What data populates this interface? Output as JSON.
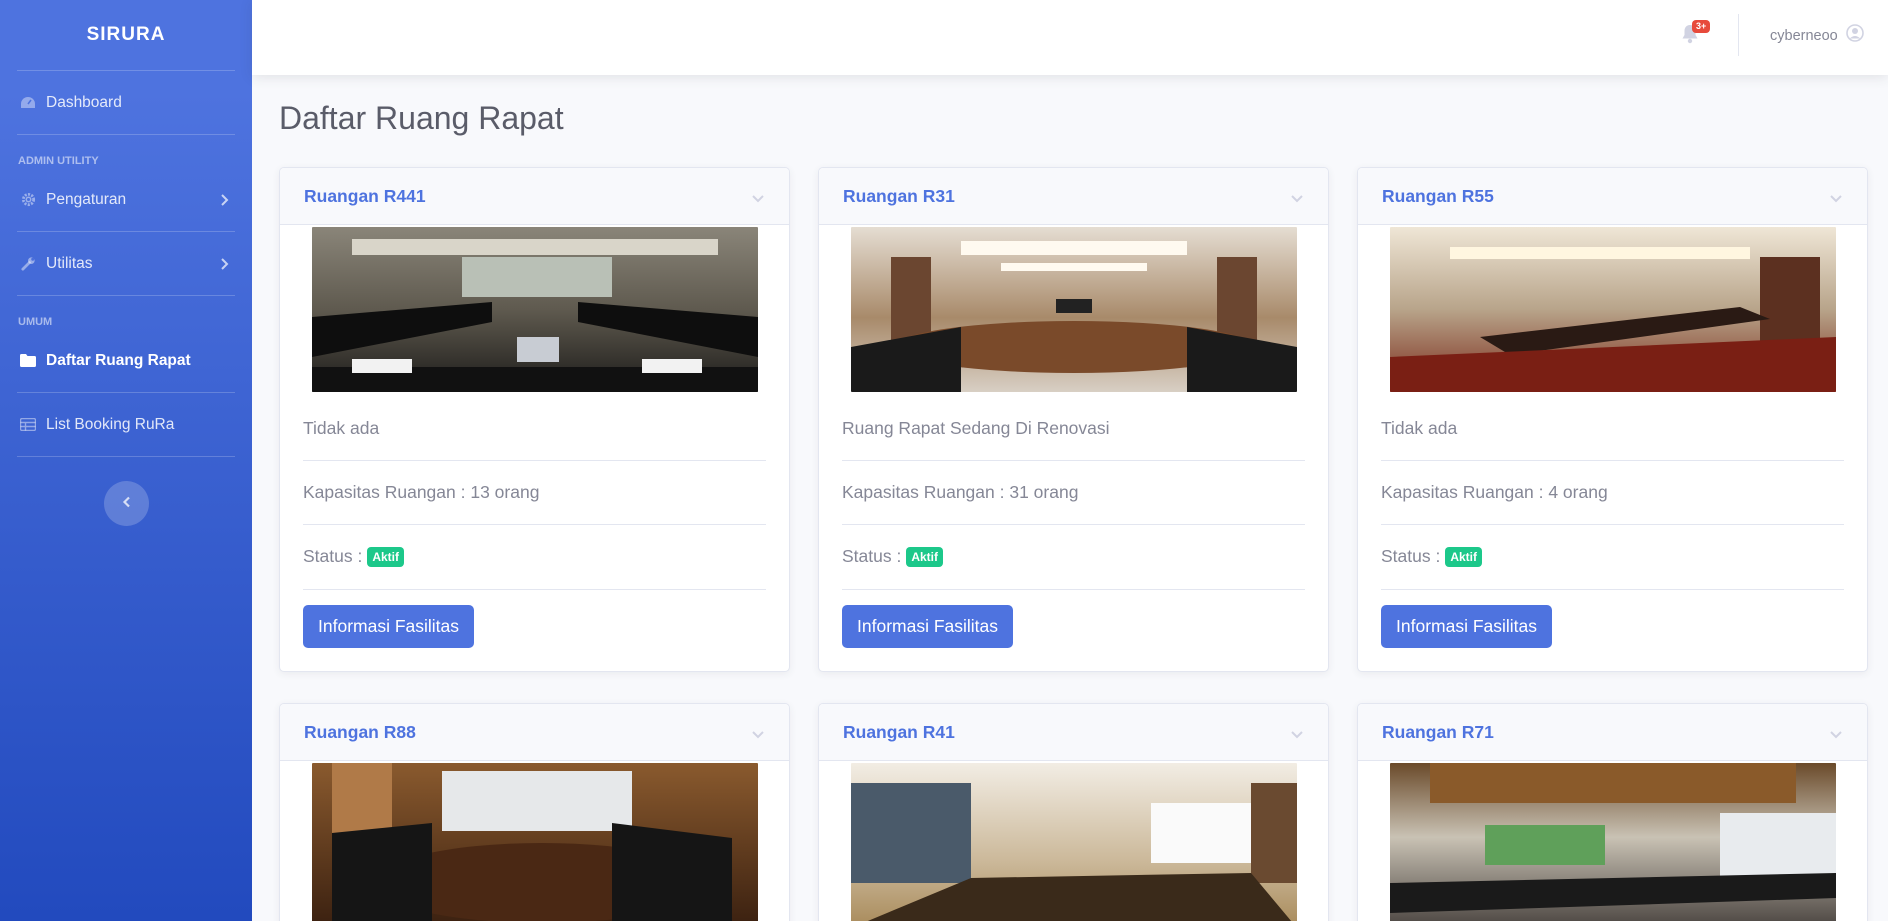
{
  "app": {
    "brand": "SIRURA"
  },
  "sidebar": {
    "dashboard": "Dashboard",
    "heading_admin": "Admin Utility",
    "pengaturan": "Pengaturan",
    "utilitas": "Utilitas",
    "heading_umum": "Umum",
    "daftar_ruang": "Daftar Ruang Rapat",
    "list_booking": "List Booking RuRa"
  },
  "topbar": {
    "notification_count": "3+",
    "username": "cyberneoo"
  },
  "page": {
    "title": "Daftar Ruang Rapat"
  },
  "rooms": [
    {
      "name": "Ruangan R441",
      "desc": "Tidak ada",
      "capacity": "Kapasitas Ruangan : 13 orang",
      "status_label": "Status :",
      "status": "Aktif",
      "button": "Informasi Fasilitas"
    },
    {
      "name": "Ruangan R31",
      "desc": "Ruang Rapat Sedang Di Renovasi",
      "capacity": "Kapasitas Ruangan : 31 orang",
      "status_label": "Status :",
      "status": "Aktif",
      "button": "Informasi Fasilitas"
    },
    {
      "name": "Ruangan R55",
      "desc": "Tidak ada",
      "capacity": "Kapasitas Ruangan : 4 orang",
      "status_label": "Status :",
      "status": "Aktif",
      "button": "Informasi Fasilitas"
    },
    {
      "name": "Ruangan R88"
    },
    {
      "name": "Ruangan R41"
    },
    {
      "name": "Ruangan R71"
    }
  ],
  "colors": {
    "primary": "#4e73df",
    "success": "#1cc88a",
    "danger": "#e74a3b",
    "text_muted": "#858796"
  },
  "icons": {
    "dashboard": "tachometer-icon",
    "pengaturan": "gear-icon",
    "utilitas": "wrench-icon",
    "daftar_ruang": "folder-icon",
    "list_booking": "table-icon",
    "bell": "bell-icon",
    "user": "user-circle-icon"
  }
}
